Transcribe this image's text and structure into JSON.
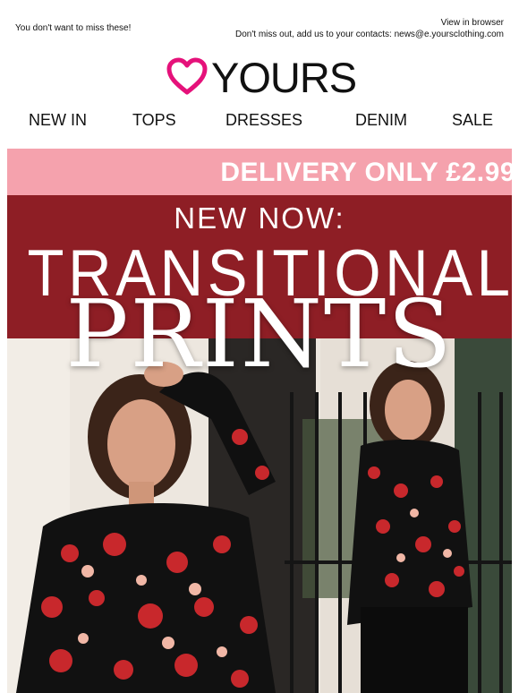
{
  "preheader": {
    "left_text": "You don't want to miss these!",
    "view_in_browser": "View in browser",
    "contacts_text": "Don't miss out, add us to your contacts: news@e.yoursclothing.com"
  },
  "brand": {
    "name": "YOURS",
    "accent": "#e5117a",
    "icon": "heart-outline-icon"
  },
  "nav": {
    "items": [
      "NEW IN",
      "TOPS",
      "DRESSES",
      "DENIM",
      "SALE"
    ]
  },
  "banner": {
    "text": "DELIVERY ONLY £2.99",
    "background": "#f5a2ad"
  },
  "hero": {
    "subtitle": "NEW NOW:",
    "title": "TRANSITIONAL",
    "title_serif": "PRINTS",
    "background": "#8e1e25"
  }
}
